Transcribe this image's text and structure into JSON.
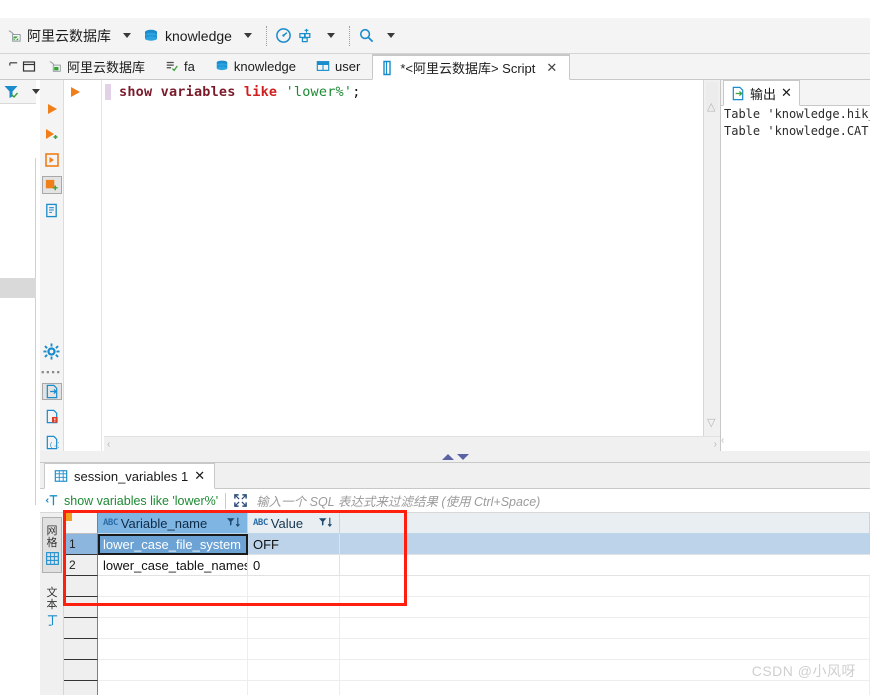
{
  "app": {
    "toolbar": {
      "connection": {
        "label": "阿里云数据库",
        "icon": "database-connection-icon"
      },
      "database": {
        "label": "knowledge",
        "icon": "database-icon"
      },
      "dashboard_icon": "dashboard-gauge-icon",
      "server_icon": "server-rack-icon",
      "search_icon": "search-icon"
    },
    "editor_tabs": [
      {
        "label": "阿里云数据库",
        "icon": "connection-icon",
        "active": false,
        "closable": false
      },
      {
        "label": "fa",
        "icon": "sql-script-icon",
        "active": false,
        "closable": false
      },
      {
        "label": "knowledge",
        "icon": "database-icon",
        "active": false,
        "closable": false
      },
      {
        "label": "user",
        "icon": "table-icon",
        "active": false,
        "closable": false
      },
      {
        "label": "*<阿里云数据库> Script",
        "icon": "script-file-icon",
        "active": true,
        "closable": true
      }
    ],
    "left_rail": {
      "filter_icon": "filter-icon",
      "view_menu_icon": "view-menu-icon",
      "maximize_icon": "maximize-panel-icon"
    },
    "editor_icon_column": [
      "execute-statement-icon",
      "execute-script-icon",
      "execute-new-tab-icon",
      "execute-expression-icon",
      "explain-plan-icon",
      "sql-settings-icon",
      "export-results-icon",
      "sql-error-icon",
      "sql-template-icon"
    ],
    "sql_editor": {
      "tokens": [
        {
          "text": "show variables",
          "type": "keyword"
        },
        {
          "text": " ",
          "type": "plain"
        },
        {
          "text": "like",
          "type": "keyword2"
        },
        {
          "text": " ",
          "type": "plain"
        },
        {
          "text": "'lower%'",
          "type": "string"
        },
        {
          "text": ";",
          "type": "punct"
        }
      ],
      "full_text": "show variables like 'lower%';"
    },
    "output_panel": {
      "tab_label": "输出",
      "close_icon": "close-icon",
      "lines": [
        "Table 'knowledge.hik_",
        "Table 'knowledge.CAT"
      ]
    },
    "results_panel": {
      "tab_label": "session_variables 1",
      "tab_icon": "grid-icon",
      "close_icon": "close-icon",
      "filter": {
        "prefix_icon": "filter-text-icon",
        "expression": "show variables like 'lower%'",
        "expand_icon": "expand-icon",
        "placeholder": "输入一个 SQL 表达式来过滤结果 (使用 Ctrl+Space)"
      },
      "side_tabs": [
        {
          "label": "网格",
          "icon": "grid-view-icon",
          "selected": true
        },
        {
          "label": "文本",
          "icon": "text-view-icon",
          "selected": false
        },
        {
          "label": "",
          "icon": "record-view-icon",
          "selected": false
        }
      ]
    },
    "grid": {
      "columns": [
        {
          "name": "Variable_name",
          "type_badge": "ABC",
          "sort_icon": "filter-sort-icon"
        },
        {
          "name": "Value",
          "type_badge": "ABC",
          "sort_icon": "filter-sort-icon"
        }
      ],
      "rows": [
        {
          "num": "1",
          "Variable_name": "lower_case_file_system",
          "Value": "OFF",
          "selected": true,
          "focused_cell": "Variable_name"
        },
        {
          "num": "2",
          "Variable_name": "lower_case_table_names",
          "Value": "0",
          "selected": false,
          "focused_cell": null
        }
      ],
      "empty_row_count": 6
    },
    "annotation": {
      "shape": "rectangle",
      "color": "#ff1f0f"
    },
    "watermark": "CSDN @小风呀"
  }
}
